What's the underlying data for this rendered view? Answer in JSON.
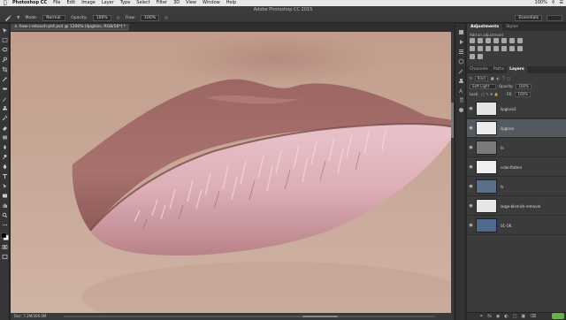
{
  "menubar": {
    "apple": "",
    "items": [
      "Photoshop CC",
      "File",
      "Edit",
      "Image",
      "Layer",
      "Type",
      "Select",
      "Filter",
      "3D",
      "View",
      "Window",
      "Help"
    ],
    "right_status": "100%"
  },
  "app_title": "Adobe Photoshop CC 2015",
  "options_bar": {
    "mode_label": "Mode:",
    "mode_value": "Normal",
    "opacity_label": "Opacity:",
    "opacity_value": "100%",
    "flow_label": "Flow:",
    "flow_value": "100%",
    "workspace": "Essentials"
  },
  "document_tab": "how-i-retouch-pt4.psd @ 1200% (lipgloss, RGB/16*) *",
  "status_bar": "Doc: 7.2M/306.0M",
  "adjustments": {
    "tabs": [
      "Adjustments",
      "Styles"
    ],
    "subtitle": "Add an adjustment"
  },
  "layers_panel": {
    "tabs": [
      "Channels",
      "Paths",
      "Layers"
    ],
    "kind_label": "Kind",
    "blend_mode": "Soft Light",
    "opacity_label": "Opacity:",
    "opacity_value": "100%",
    "lock_label": "Lock:",
    "fill_label": "Fill:",
    "fill_value": "100%",
    "layers": [
      {
        "name": "lipgloss2",
        "thumb": "#e4e4e4",
        "selected": false
      },
      {
        "name": "lipgloss",
        "thumb": "#ececec",
        "selected": true
      },
      {
        "name": "hi",
        "thumb": "#7a7a7a",
        "selected": false
      },
      {
        "name": "color-flatten",
        "thumb": "#efefef",
        "selected": false
      },
      {
        "name": "fs",
        "thumb": "#5a6f8a",
        "selected": false
      },
      {
        "name": "large-blemish-removal",
        "thumb": "#e6e6e6",
        "selected": false
      },
      {
        "name": "01-OK",
        "thumb": "#4f6a8f",
        "selected": false
      }
    ]
  },
  "colors": {
    "skin": "#c9a898",
    "lip_upper": "#a8716e",
    "lip_lower": "#d9a9b2",
    "accent": "#6ab04c"
  }
}
